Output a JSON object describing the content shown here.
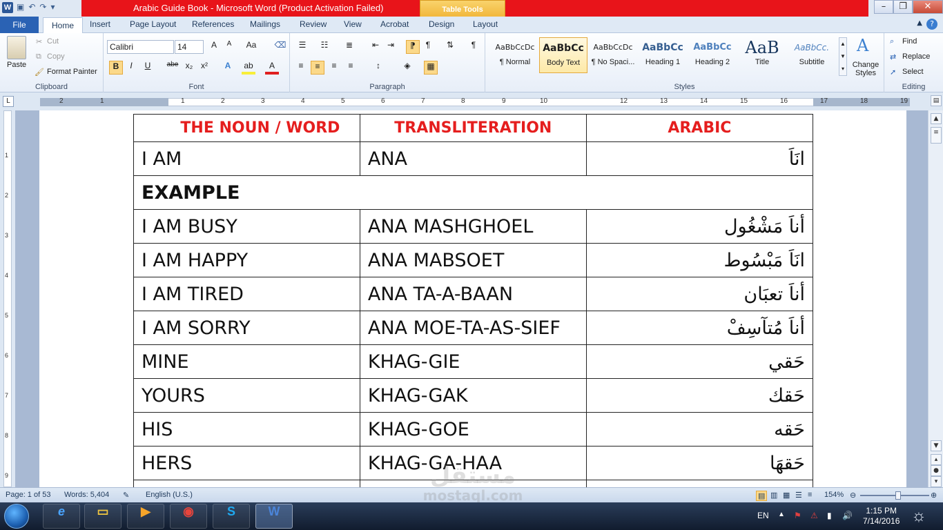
{
  "titlebar": {
    "title": "Arabic Guide Book  -  Microsoft Word (Product Activation Failed)",
    "context_tab": "Table Tools",
    "app_icon": "W",
    "minimize": "–",
    "restore": "❐",
    "close": "✕"
  },
  "tabs": {
    "file": "File",
    "home": "Home",
    "insert": "Insert",
    "page_layout": "Page Layout",
    "references": "References",
    "mailings": "Mailings",
    "review": "Review",
    "view": "View",
    "acrobat": "Acrobat",
    "design": "Design",
    "layout": "Layout",
    "help": "?"
  },
  "clipboard": {
    "paste": "Paste",
    "cut": "Cut",
    "copy": "Copy",
    "format_painter": "Format Painter",
    "group_label": "Clipboard"
  },
  "font": {
    "font_name": "Calibri",
    "font_size": "14",
    "grow": "A",
    "shrink": "A",
    "change_case": "Aa",
    "bold": "B",
    "italic": "I",
    "underline": "U",
    "strike": "abe",
    "subscript": "x₂",
    "superscript": "x²",
    "text_effects": "A",
    "highlight": "ab",
    "font_color": "A",
    "group_label": "Font"
  },
  "paragraph": {
    "show_marks": "¶",
    "group_label": "Paragraph"
  },
  "styles": {
    "items": [
      {
        "preview": "AaBbCcDc",
        "name": "¶ Normal"
      },
      {
        "preview": "AaBbCc",
        "name": "Body Text"
      },
      {
        "preview": "AaBbCcDc",
        "name": "¶ No Spaci..."
      },
      {
        "preview": "AaBbCc",
        "name": "Heading 1"
      },
      {
        "preview": "AaBbCc",
        "name": "Heading 2"
      },
      {
        "preview": "AaB",
        "name": "Title"
      },
      {
        "preview": "AaBbCc.",
        "name": "Subtitle"
      }
    ],
    "change_styles": "Change Styles",
    "group_label": "Styles"
  },
  "editing": {
    "find": "Find",
    "replace": "Replace",
    "select": "Select",
    "group_label": "Editing"
  },
  "document": {
    "header": [
      "THE NOUN / WORD",
      "TRANSLITERATION",
      "ARABIC"
    ],
    "rows": [
      [
        "I AM",
        "ANA",
        "انَاَ"
      ],
      [
        "EXAMPLE"
      ],
      [
        "I AM BUSY",
        "ANA MASHGHOEL",
        "أناَ مَشْغُول"
      ],
      [
        "I AM HAPPY",
        "ANA MABSOET",
        "انَاَ مَبْسُوط"
      ],
      [
        "I AM TIRED",
        "ANA TA-A-BAAN",
        "أناَ تعبَان"
      ],
      [
        "I AM SORRY",
        "ANA MOE-TA-AS-SIEF",
        "أناَ مُتآسِفْ"
      ],
      [
        "MINE",
        "KHAG-GIE",
        "حَقي"
      ],
      [
        "YOURS",
        "KHAG-GAK",
        "حَقك"
      ],
      [
        "HIS",
        "KHAG-GOE",
        "حَقه"
      ],
      [
        "HERS",
        "KHAG-GA-HAA",
        "حَقهَا"
      ]
    ]
  },
  "status": {
    "page": "Page: 1 of 53",
    "words": "Words: 5,404",
    "language": "English (U.S.)",
    "zoom": "154%"
  },
  "watermark": {
    "line1": "مستقل",
    "line2": "mostaql.com"
  },
  "taskbar": {
    "lang": "EN",
    "time": "1:15 PM",
    "date": "7/14/2016"
  }
}
